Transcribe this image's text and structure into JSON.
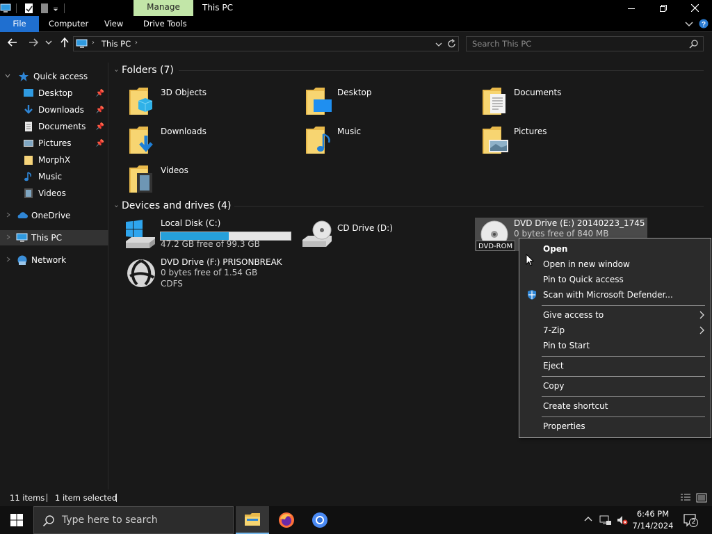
{
  "titlebar": {
    "manage_tab": "Manage",
    "title": "This PC",
    "minimize": "—",
    "maximize": "❐",
    "close": "✕"
  },
  "ribbon": {
    "tabs": [
      "File",
      "Computer",
      "View",
      "Drive Tools"
    ],
    "collapse_icon": "chevron-down-icon",
    "help_icon": "help-icon"
  },
  "address": {
    "path": "This PC",
    "search_placeholder": "Search This PC"
  },
  "nav": {
    "quick_access": "Quick access",
    "quick_items": [
      {
        "label": "Desktop",
        "pinned": true
      },
      {
        "label": "Downloads",
        "pinned": true
      },
      {
        "label": "Documents",
        "pinned": true
      },
      {
        "label": "Pictures",
        "pinned": true
      },
      {
        "label": "MorphX",
        "pinned": false
      },
      {
        "label": "Music",
        "pinned": false
      },
      {
        "label": "Videos",
        "pinned": false
      }
    ],
    "onedrive": "OneDrive",
    "this_pc": "This PC",
    "network": "Network"
  },
  "folders": {
    "header": "Folders (7)",
    "items": [
      "3D Objects",
      "Desktop",
      "Documents",
      "Downloads",
      "Music",
      "Pictures",
      "Videos"
    ]
  },
  "devices": {
    "header": "Devices and drives (4)",
    "local_disk": {
      "name": "Local Disk (C:)",
      "free": "47.2 GB free of 99.3 GB",
      "used_fraction": 0.525
    },
    "cd_drive": {
      "name": "CD Drive (D:)"
    },
    "dvd_e": {
      "name": "DVD Drive (E:) 20140223_1745",
      "free": "0 bytes free of 840 MB",
      "tooltip": "DVD-ROM"
    },
    "dvd_f": {
      "name": "DVD Drive (F:) PRISONBREAK",
      "free": "0 bytes free of 1.54 GB",
      "fs": "CDFS"
    }
  },
  "context_menu": {
    "open": "Open",
    "open_new_window": "Open in new window",
    "pin_quick_access": "Pin to Quick access",
    "scan_defender": "Scan with Microsoft Defender...",
    "give_access": "Give access to",
    "seven_zip": "7-Zip",
    "pin_start": "Pin to Start",
    "eject": "Eject",
    "copy": "Copy",
    "create_shortcut": "Create shortcut",
    "properties": "Properties"
  },
  "status": {
    "items": "11 items",
    "selected": "1 item selected"
  },
  "taskbar": {
    "search_placeholder": "Type here to search",
    "time": "6:46 PM",
    "date": "7/14/2024",
    "notifications": "2"
  },
  "colors": {
    "accent": "#1f6fd0",
    "manage_tab": "#c2e6a8",
    "drive_bar": "#26a0da",
    "background": "#191919"
  }
}
